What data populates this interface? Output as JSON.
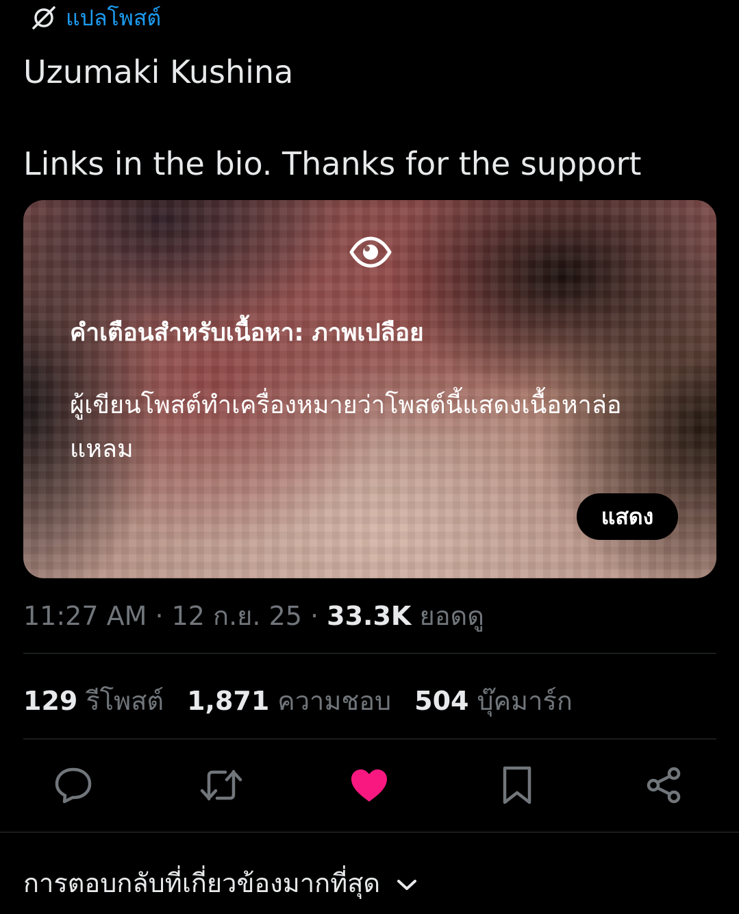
{
  "translate": {
    "label": "แปลโพสต์",
    "icon": "globe-slash-icon"
  },
  "post": {
    "author_line": "Uzumaki Kushina",
    "text": "Links in the bio. Thanks for the support"
  },
  "media_warning": {
    "icon": "eye-icon",
    "title": "คำเตือนสำหรับเนื้อหา: ภาพเปลือย",
    "description": "ผู้เขียนโพสต์ทำเครื่องหมายว่าโพสต์นี้แสดงเนื้อหาล่อแหลม",
    "show_button": "แสดง"
  },
  "meta": {
    "time": "11:27 AM",
    "separator": " · ",
    "date": "12 ก.ย. 25",
    "views_count": "33.3K",
    "views_label": "ยอดดู"
  },
  "stats": {
    "reposts_count": "129",
    "reposts_label": "รีโพสต์",
    "likes_count": "1,871",
    "likes_label": "ความชอบ",
    "bookmarks_count": "504",
    "bookmarks_label": "บุ๊คมาร์ก"
  },
  "actions": [
    {
      "name": "reply",
      "icon": "reply-icon"
    },
    {
      "name": "repost",
      "icon": "repost-icon"
    },
    {
      "name": "like",
      "icon": "heart-icon",
      "active": true
    },
    {
      "name": "bookmark",
      "icon": "bookmark-icon"
    },
    {
      "name": "share",
      "icon": "share-icon"
    }
  ],
  "replies_sort": {
    "label": "การตอบกลับที่เกี่ยวข้องมากที่สุด",
    "icon": "chevron-down-icon"
  },
  "colors": {
    "background": "#000000",
    "text_primary": "#e7e9ea",
    "text_secondary": "#71767b",
    "link_blue": "#1d9bf0",
    "like_pink": "#f91880",
    "divider": "#2f3336"
  }
}
